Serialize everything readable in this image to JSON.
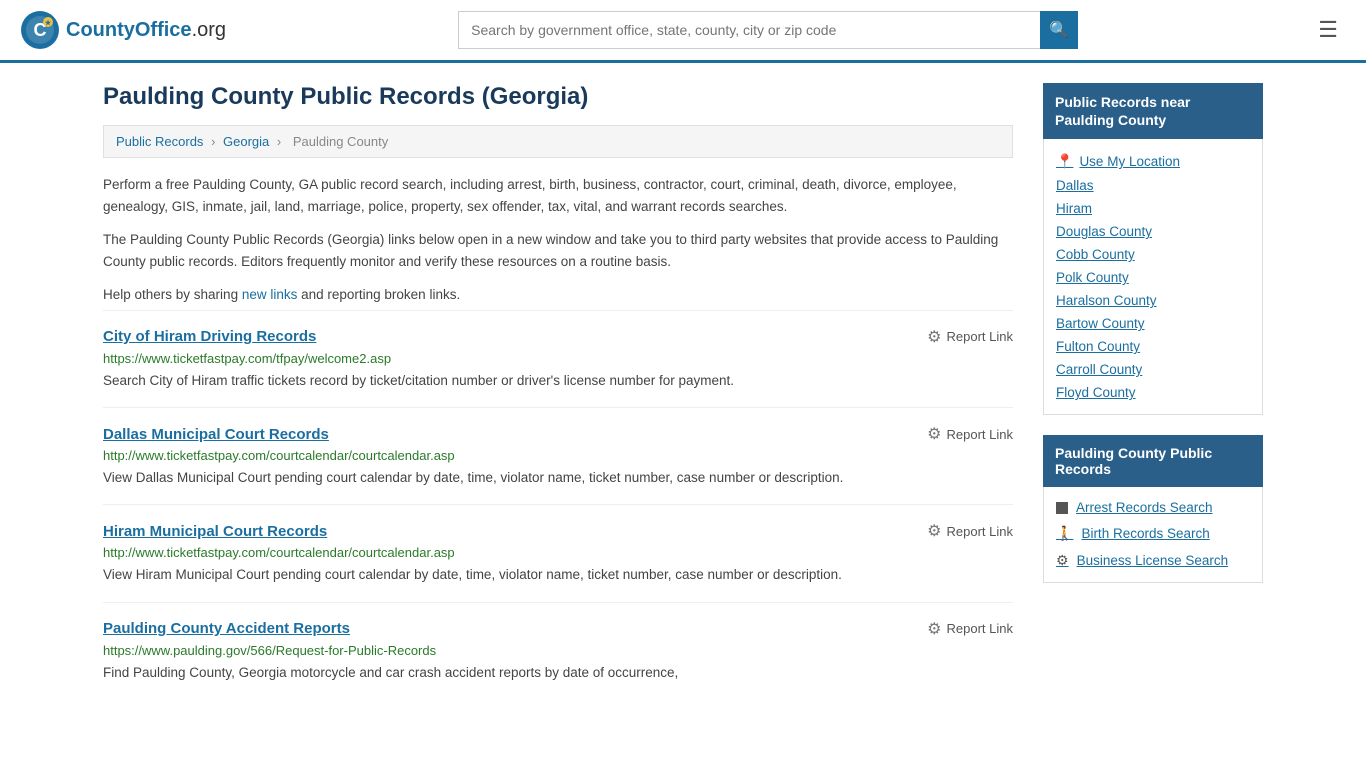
{
  "header": {
    "logo_text": "CountyOffice",
    "logo_suffix": ".org",
    "search_placeholder": "Search by government office, state, county, city or zip code",
    "menu_icon": "☰"
  },
  "page": {
    "title": "Paulding County Public Records (Georgia)",
    "breadcrumb": {
      "items": [
        "Public Records",
        "Georgia",
        "Paulding County"
      ]
    },
    "intro1": "Perform a free Paulding County, GA public record search, including arrest, birth, business, contractor, court, criminal, death, divorce, employee, genealogy, GIS, inmate, jail, land, marriage, police, property, sex offender, tax, vital, and warrant records searches.",
    "intro2": "The Paulding County Public Records (Georgia) links below open in a new window and take you to third party websites that provide access to Paulding County public records. Editors frequently monitor and verify these resources on a routine basis.",
    "intro3_prefix": "Help others by sharing ",
    "intro3_link": "new links",
    "intro3_suffix": " and reporting broken links."
  },
  "records": [
    {
      "title": "City of Hiram Driving Records",
      "url": "https://www.ticketfastpay.com/tfpay/welcome2.asp",
      "description": "Search City of Hiram traffic tickets record by ticket/citation number or driver's license number for payment.",
      "report_label": "Report Link"
    },
    {
      "title": "Dallas Municipal Court Records",
      "url": "http://www.ticketfastpay.com/courtcalendar/courtcalendar.asp",
      "description": "View Dallas Municipal Court pending court calendar by date, time, violator name, ticket number, case number or description.",
      "report_label": "Report Link"
    },
    {
      "title": "Hiram Municipal Court Records",
      "url": "http://www.ticketfastpay.com/courtcalendar/courtcalendar.asp",
      "description": "View Hiram Municipal Court pending court calendar by date, time, violator name, ticket number, case number or description.",
      "report_label": "Report Link"
    },
    {
      "title": "Paulding County Accident Reports",
      "url": "https://www.paulding.gov/566/Request-for-Public-Records",
      "description": "Find Paulding County, Georgia motorcycle and car crash accident reports by date of occurrence,",
      "report_label": "Report Link"
    }
  ],
  "sidebar": {
    "nearby_header": "Public Records near Paulding County",
    "use_location": "Use My Location",
    "cities": [
      "Dallas",
      "Hiram"
    ],
    "counties": [
      "Douglas County",
      "Cobb County",
      "Polk County",
      "Haralson County",
      "Bartow County",
      "Fulton County",
      "Carroll County",
      "Floyd County"
    ],
    "records_header": "Paulding County Public Records",
    "record_links": [
      {
        "icon": "square",
        "label": "Arrest Records Search"
      },
      {
        "icon": "person",
        "label": "Birth Records Search"
      },
      {
        "icon": "biz",
        "label": "Business License Search"
      }
    ]
  }
}
